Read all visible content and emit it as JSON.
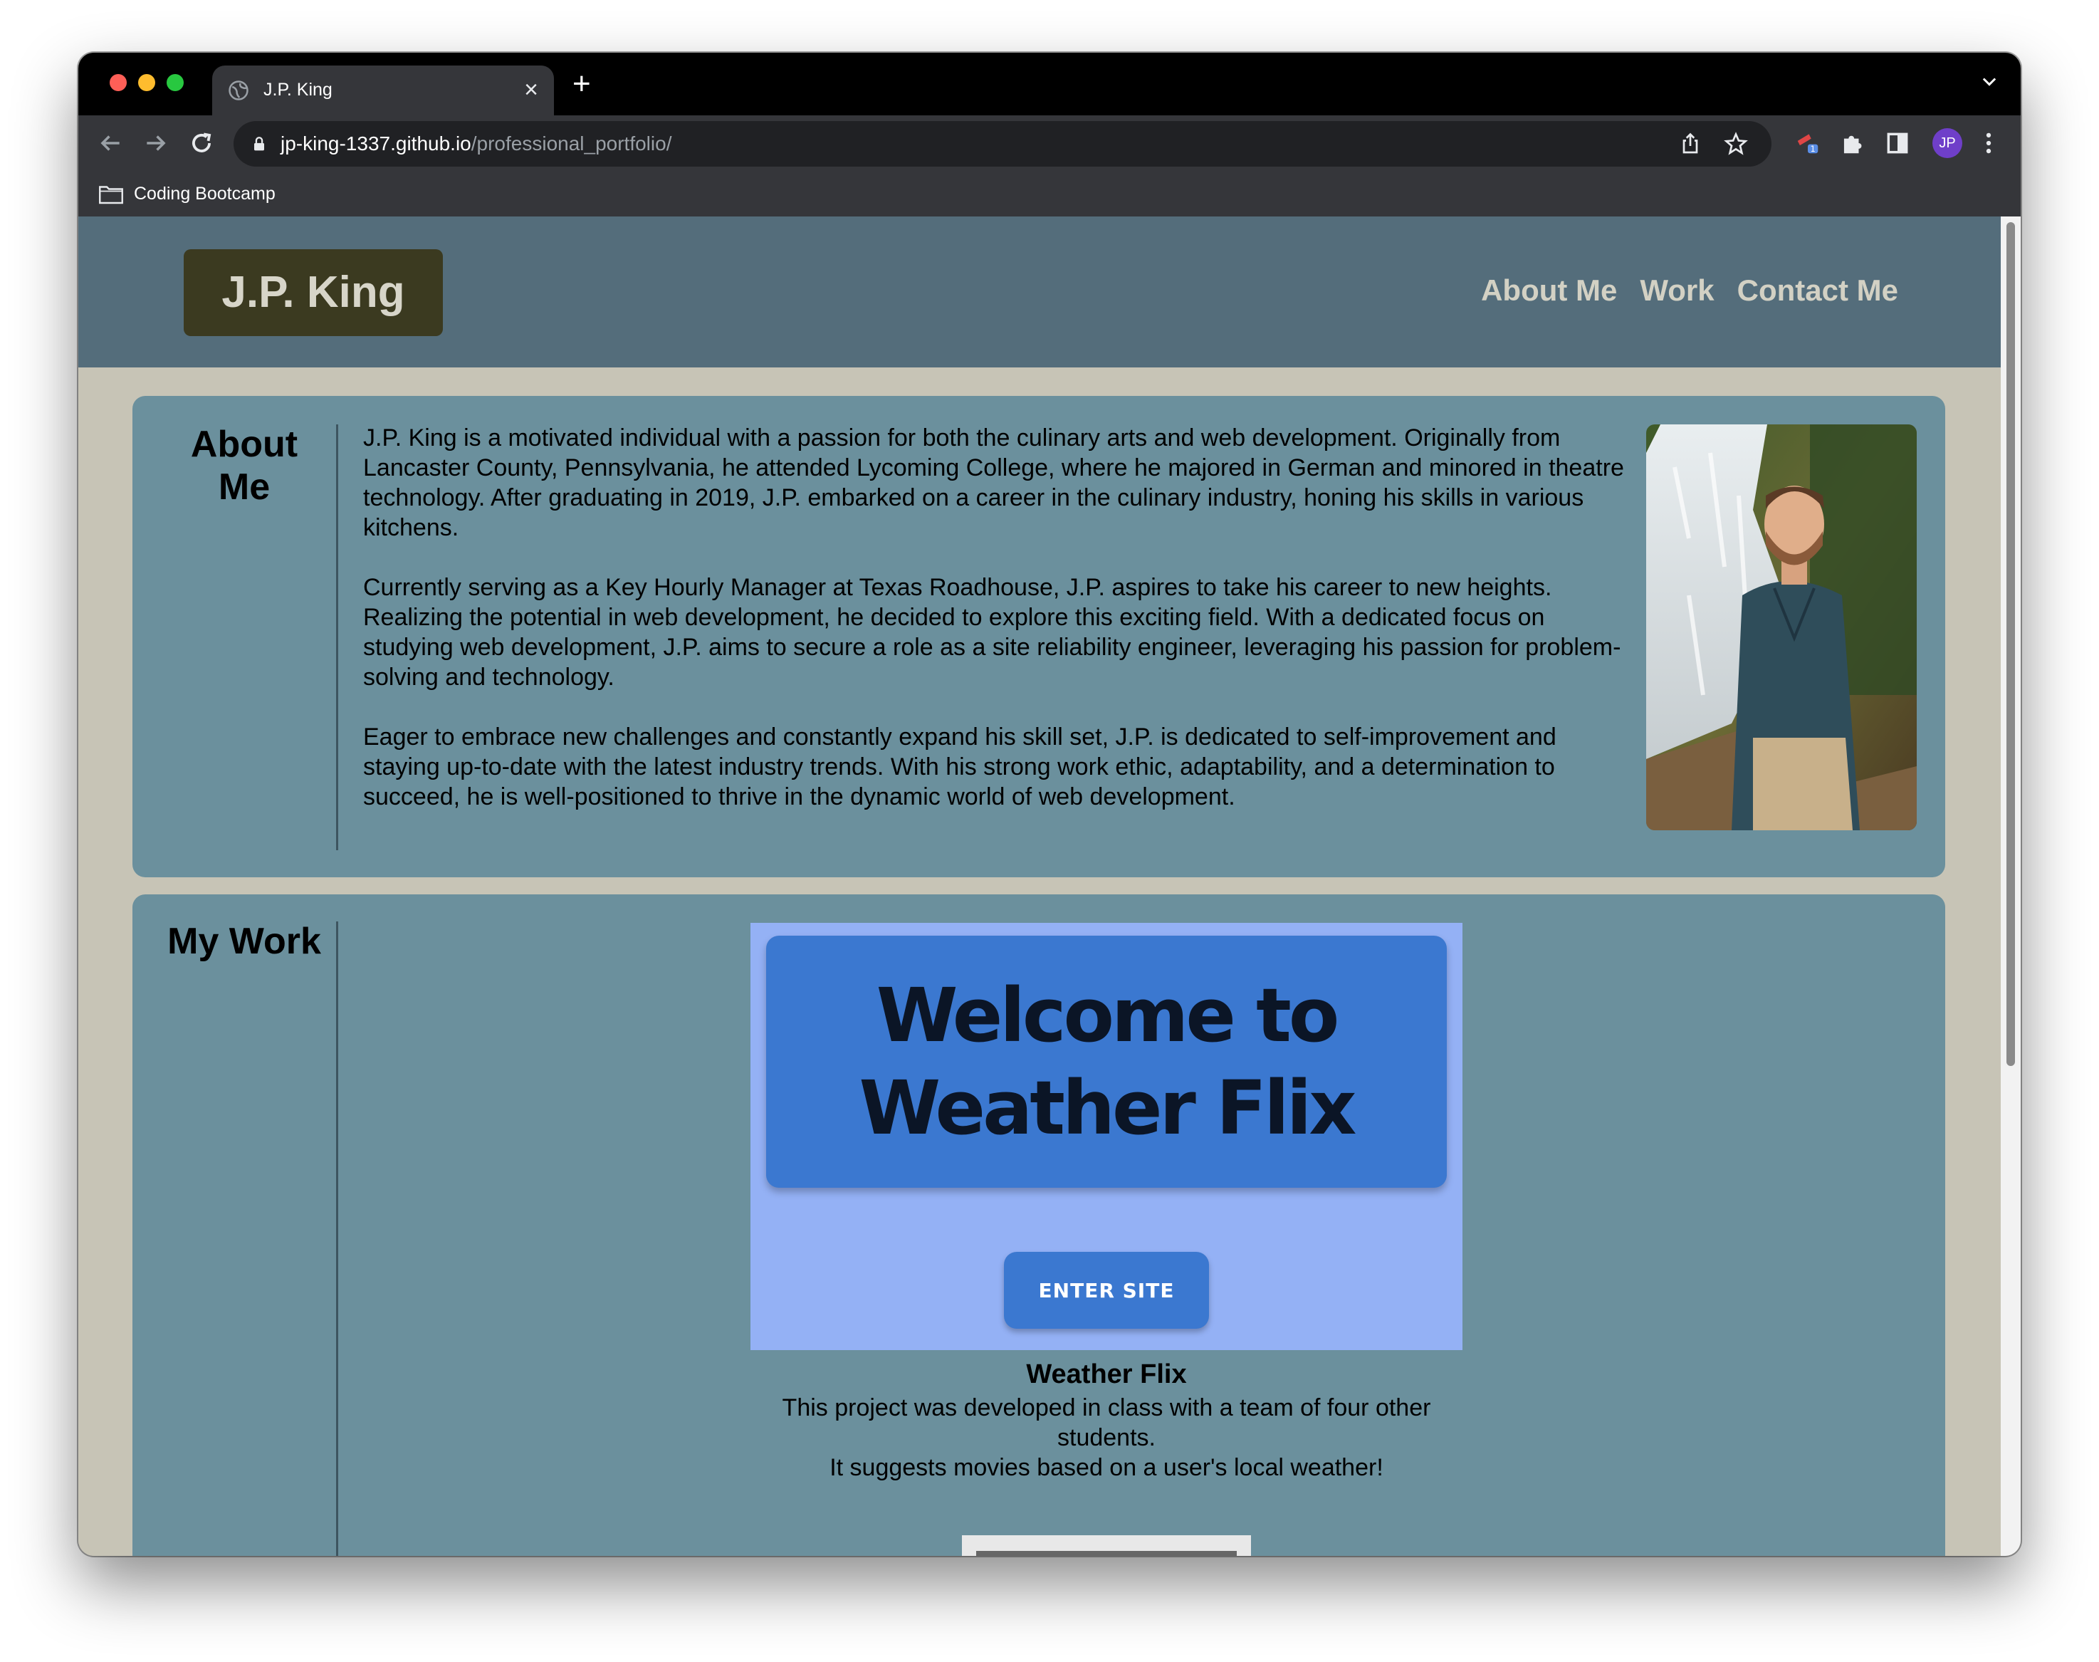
{
  "browser": {
    "tab_title": "J.P. King",
    "new_tab_symbol": "+",
    "close_symbol": "×",
    "url_host": "jp-king-1337.github.io",
    "url_path": "/professional_portfolio/",
    "bookmark_folder": "Coding Bootcamp",
    "profile_initials": "JP",
    "extension_badge": "1",
    "icons": [
      "globe-icon",
      "back-icon",
      "forward-icon",
      "reload-icon",
      "lock-icon",
      "share-icon",
      "star-icon",
      "extension-icon",
      "puzzle-icon",
      "sidebar-icon",
      "menu-icon",
      "folder-icon",
      "chevron-down-icon"
    ]
  },
  "site": {
    "logo": "J.P. King",
    "nav": [
      "About Me",
      "Work",
      "Contact Me"
    ],
    "colors": {
      "header": "#546d7b",
      "logo_bg": "#3b3a20",
      "card": "#6b909d",
      "page_bg": "#c7c4b6"
    }
  },
  "about": {
    "title": "About Me",
    "paragraphs": [
      "J.P. King is a motivated individual with a passion for both the culinary arts and web development. Originally from Lancaster County, Pennsylvania, he attended Lycoming College, where he majored in German and minored in theatre technology. After graduating in 2019, J.P. embarked on a career in the culinary industry, honing his skills in various kitchens.",
      "Currently serving as a Key Hourly Manager at Texas Roadhouse, J.P. aspires to take his career to new heights. Realizing the potential in web development, he decided to explore this exciting field. With a dedicated focus on studying web development, J.P. aims to secure a role as a site reliability engineer, leveraging his passion for problem-solving and technology.",
      "Eager to embrace new challenges and constantly expand his skill set, J.P. is dedicated to self-improvement and staying up-to-date with the latest industry trends. With his strong work ethic, adaptability, and a determination to succeed, he is well-positioned to thrive in the dynamic world of web development."
    ]
  },
  "work": {
    "title": "My Work",
    "projects": [
      {
        "screenshot_heading": "Welcome to Weather Flix",
        "screenshot_button": "ENTER SITE",
        "name": "Weather Flix",
        "description_lines": [
          "This project was developed in class with a team of four other students.",
          "It suggests movies based on a user's local weather!"
        ]
      }
    ]
  }
}
